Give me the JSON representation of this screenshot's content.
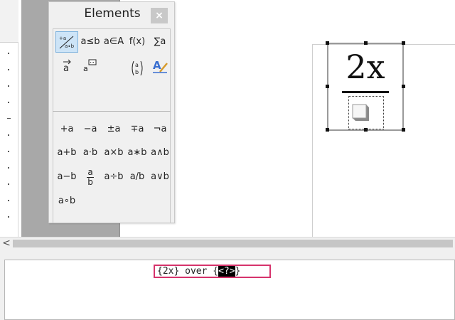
{
  "elements_panel": {
    "title": "Elements",
    "close_glyph": "×",
    "category_buttons": [
      "unary-binary-operators",
      "a≤b",
      "a∈A",
      "f(x)",
      "∑a",
      "attributes",
      "brackets",
      "formats",
      "others"
    ],
    "operator_rows": [
      [
        "+a",
        "−a",
        "±a",
        "∓a",
        "¬a"
      ],
      [
        "a+b",
        "a⋅b",
        "a×b",
        "a∗b",
        "a∧b"
      ],
      [
        "a−b",
        "a/b (fraction)",
        "a÷b",
        "a/b",
        "a∨b"
      ],
      [
        "a∘b"
      ]
    ]
  },
  "category_labels": {
    "relations": "a≤b",
    "set": "a∈A",
    "functions": "f(x)",
    "operators": "∑a",
    "brackets_text": "(a/b)"
  },
  "operators": {
    "plus_a": "+a",
    "minus_a": "−a",
    "plusminus_a": "±a",
    "minusplus_a": "∓a",
    "neg_a": "¬a",
    "a_plus_b": "a+b",
    "a_cdot_b": "a⋅b",
    "a_times_b": "a×b",
    "a_ast_b": "a∗b",
    "a_and_b": "a∧b",
    "a_minus_b": "a−b",
    "frac_num": "a",
    "frac_den": "b",
    "a_div_b": "a÷b",
    "a_slash_b": "a/b",
    "a_or_b": "a∨b",
    "a_circ_b": "a∘b"
  },
  "formula": {
    "numerator": "2x"
  },
  "command": {
    "prefix": "{2x} over {",
    "placeholder": "<?>",
    "suffix": "}"
  },
  "scrollbar": {
    "left_arrow": "<"
  },
  "colors": {
    "selected_bg": "#cde4f7",
    "highlight_border": "#d6336c",
    "panel_bg": "#f0f0f0"
  }
}
